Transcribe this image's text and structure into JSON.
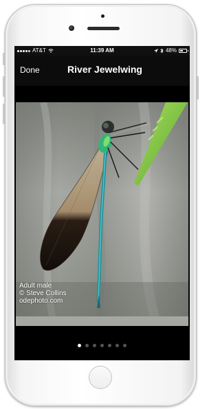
{
  "status_bar": {
    "carrier": "AT&T",
    "time": "11:39 AM",
    "battery": "48%",
    "battery_level": 0.48,
    "signal_bars_filled": 4,
    "signal_bars_total": 5,
    "icons": [
      "signal-dots-icon",
      "wifi-icon",
      "location-arrow-icon",
      "bluetooth-icon",
      "battery-icon"
    ]
  },
  "nav": {
    "done_label": "Done",
    "title": "River Jewelwing"
  },
  "photo": {
    "caption_lines": [
      "Adult male",
      "© Steve Collins",
      "odephoto.com"
    ]
  },
  "pager": {
    "page_count": 7,
    "current_index": 0
  },
  "colors": {
    "accent_body": "#2bb0b8",
    "wing_tip": "#1b1410",
    "leaf": "#7cc63a"
  }
}
